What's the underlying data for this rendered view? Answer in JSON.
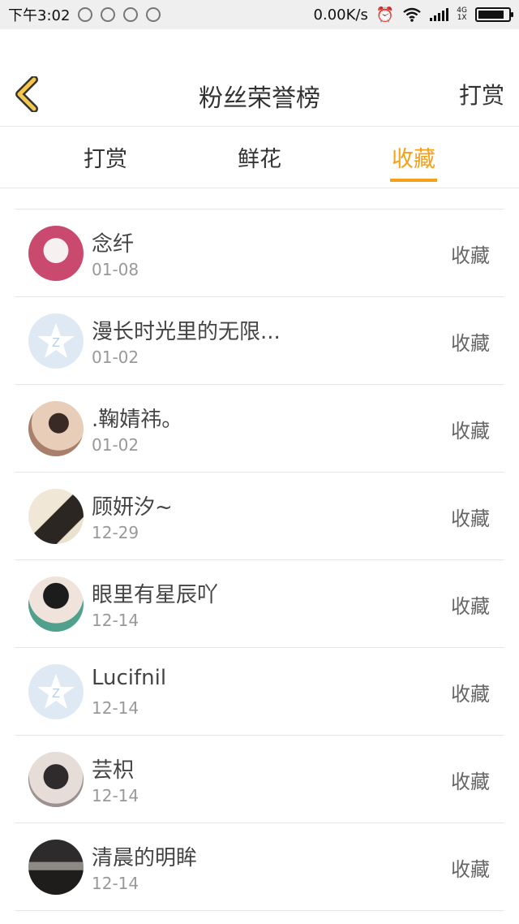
{
  "status_bar": {
    "time": "下午3:02",
    "speed": "0.00K/s",
    "network_top": "4G",
    "network_bottom": "1X",
    "battery_level": 0.85
  },
  "header": {
    "back_icon": "chevron-left-icon",
    "title": "粉丝荣誉榜",
    "action": "打赏"
  },
  "tabs": [
    {
      "label": "打赏"
    },
    {
      "label": "鲜花"
    },
    {
      "label": "收藏"
    }
  ],
  "active_tab_index": 2,
  "colors": {
    "accent": "#f5a11a",
    "back_icon_fill": "#f5c84a"
  },
  "list": [
    {
      "name": "念纤",
      "date": "01-08",
      "action": "收藏",
      "avatar": "photo"
    },
    {
      "name": "漫长时光里的无限...",
      "date": "01-02",
      "action": "收藏",
      "avatar": "default-star"
    },
    {
      "name": ".鞠婧祎。",
      "date": "01-02",
      "action": "收藏",
      "avatar": "photo"
    },
    {
      "name": "顾妍汐~",
      "date": "12-29",
      "action": "收藏",
      "avatar": "photo"
    },
    {
      "name": "眼里有星辰吖",
      "date": "12-14",
      "action": "收藏",
      "avatar": "photo"
    },
    {
      "name": "Lucifnil",
      "date": "12-14",
      "action": "收藏",
      "avatar": "default-star"
    },
    {
      "name": "芸枳",
      "date": "12-14",
      "action": "收藏",
      "avatar": "photo"
    },
    {
      "name": "清晨的明眸",
      "date": "12-14",
      "action": "收藏",
      "avatar": "photo"
    }
  ]
}
